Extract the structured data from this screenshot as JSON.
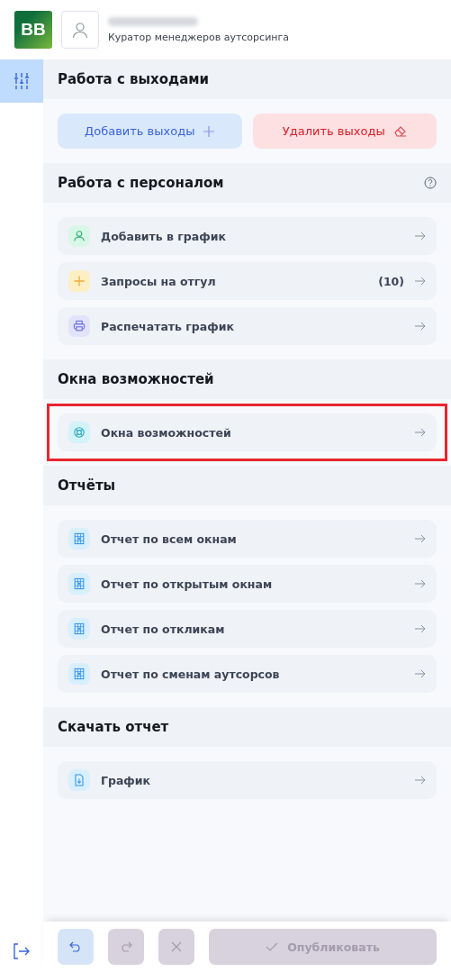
{
  "header": {
    "logo": "BB",
    "role": "Куратор менеджеров аутсорсинга"
  },
  "sidebar": {
    "items": [
      {
        "kind": "sliders",
        "selected": true
      }
    ]
  },
  "sections": [
    {
      "title": "Работа с выходами",
      "help": false,
      "buttons": [
        {
          "label": "Добавить выходы",
          "kind": "add"
        },
        {
          "label": "Удалить выходы",
          "kind": "delete"
        }
      ]
    },
    {
      "title": "Работа с персоналом",
      "help": true,
      "items": [
        {
          "label": "Добавить в график",
          "kind": "person",
          "highlighted": false
        },
        {
          "label": "Запросы на отгул",
          "kind": "plus",
          "count": "(10)",
          "highlighted": false
        },
        {
          "label": "Распечатать график",
          "kind": "printer",
          "highlighted": false
        }
      ]
    },
    {
      "title": "Окна возможностей",
      "help": false,
      "items": [
        {
          "label": "Окна возможностей",
          "kind": "lifebuoy",
          "highlighted": true
        }
      ]
    },
    {
      "title": "Отчёты",
      "help": false,
      "items": [
        {
          "label": "Отчет по всем окнам",
          "kind": "sheet",
          "highlighted": false
        },
        {
          "label": "Отчет по открытым окнам",
          "kind": "sheet",
          "highlighted": false
        },
        {
          "label": "Отчет по откликам",
          "kind": "sheet",
          "highlighted": false
        },
        {
          "label": "Отчет по сменам аутсорсов",
          "kind": "sheet",
          "highlighted": false
        }
      ]
    },
    {
      "title": "Скачать отчет",
      "help": false,
      "items": [
        {
          "label": "График",
          "kind": "file",
          "highlighted": false
        }
      ]
    }
  ],
  "toolbar": [
    {
      "kind": "undo",
      "disabled": false
    },
    {
      "kind": "redo",
      "disabled": true
    },
    {
      "kind": "cancel",
      "disabled": true
    },
    {
      "kind": "publish",
      "label": "Опубликовать",
      "disabled": true
    }
  ]
}
